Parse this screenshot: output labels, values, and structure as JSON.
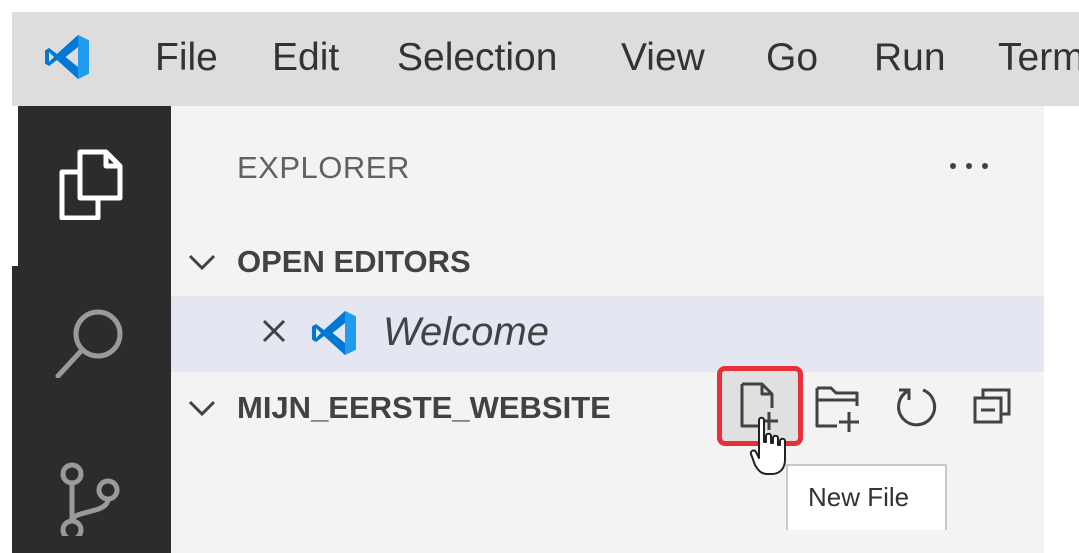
{
  "menubar": {
    "items": [
      "File",
      "Edit",
      "Selection",
      "View",
      "Go",
      "Run",
      "Term"
    ],
    "logo_icon": "vscode-logo-icon"
  },
  "activity_bar": {
    "icons": [
      "explorer-files-icon",
      "search-icon",
      "source-control-icon"
    ]
  },
  "explorer": {
    "title": "EXPLORER",
    "more_actions_icon": "ellipsis-icon",
    "open_editors": {
      "label": "OPEN EDITORS",
      "items": [
        {
          "name": "Welcome",
          "icon": "vscode-logo-icon"
        }
      ]
    },
    "folder": {
      "label": "MIJN_EERSTE_WEBSITE",
      "actions": [
        "new-file-icon",
        "new-folder-icon",
        "refresh-icon",
        "collapse-all-icon"
      ]
    }
  },
  "tooltip": {
    "text": "New File"
  },
  "colors": {
    "menubar_bg": "#dddddd",
    "activity_bar_bg": "#2c2c2c",
    "sidebar_bg": "#f3f3f3",
    "selected_row_bg": "#e4e6f1",
    "vscode_blue": "#0078d4",
    "highlight_red": "#e8303a"
  }
}
